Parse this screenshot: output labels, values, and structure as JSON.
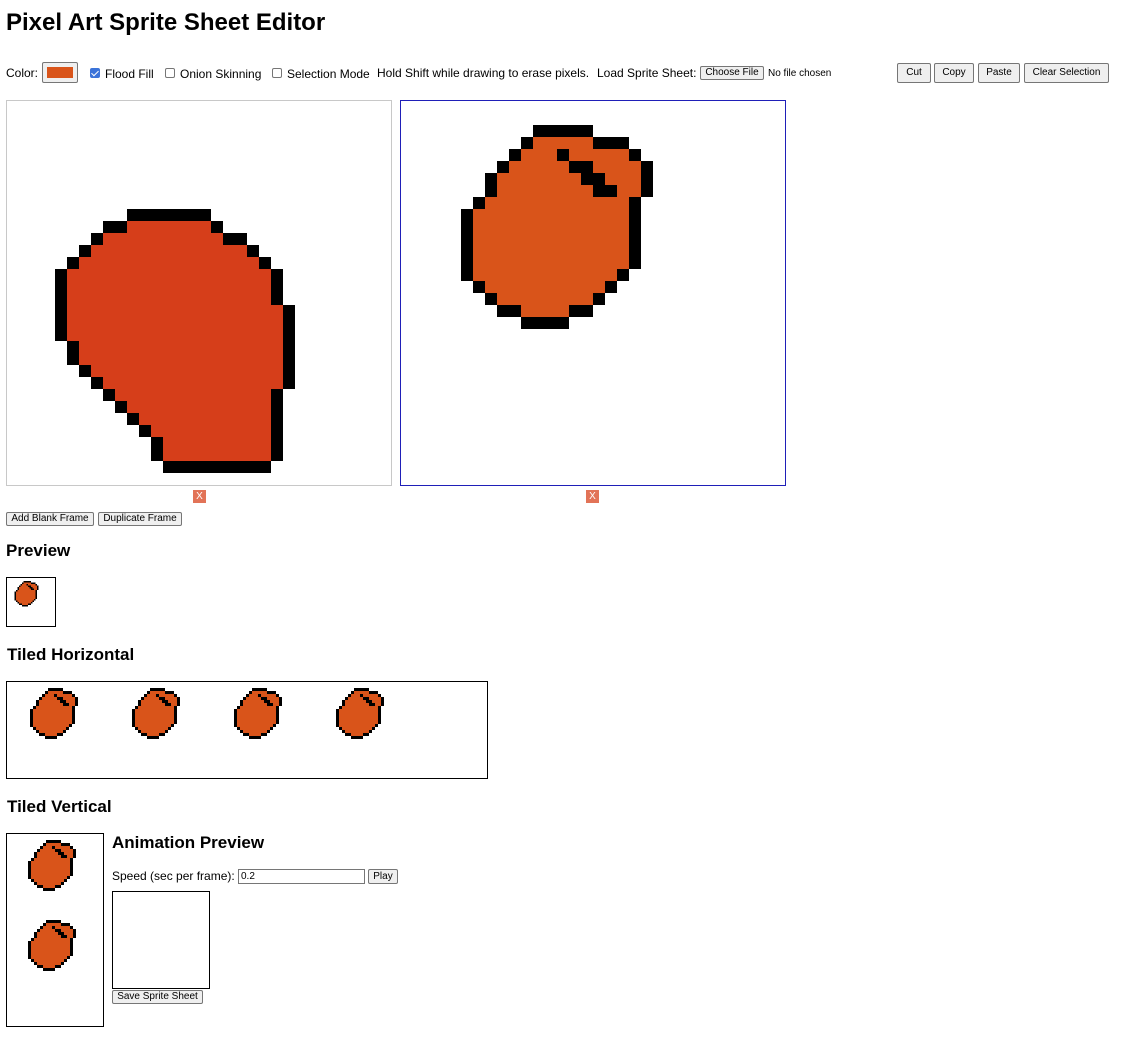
{
  "app": {
    "title": "Pixel Art Sprite Sheet Editor"
  },
  "toolbar": {
    "color_label": "Color:",
    "color_value": "#d9541a",
    "flood_fill_label": "Flood Fill",
    "flood_fill_checked": true,
    "onion_skinning_label": "Onion Skinning",
    "onion_skinning_checked": false,
    "selection_mode_label": "Selection Mode",
    "selection_mode_checked": false,
    "erase_hint": "Hold Shift while drawing to erase pixels.",
    "load_label": "Load Sprite Sheet:",
    "choose_file_label": "Choose File",
    "file_status": "No file chosen",
    "cut_label": "Cut",
    "copy_label": "Copy",
    "paste_label": "Paste",
    "clear_selection_label": "Clear Selection"
  },
  "frames": [
    {
      "selected": false,
      "fill_color": "#d63e1a",
      "delete_label": "X"
    },
    {
      "selected": true,
      "fill_color": "#d9541a",
      "delete_label": "X"
    }
  ],
  "frame_actions": {
    "add_blank_label": "Add Blank Frame",
    "duplicate_label": "Duplicate Frame"
  },
  "preview": {
    "heading": "Preview"
  },
  "tiled_horizontal": {
    "heading": "Tiled Horizontal"
  },
  "tiled_vertical": {
    "heading": "Tiled Vertical"
  },
  "animation": {
    "heading": "Animation Preview",
    "speed_label": "Speed (sec per frame):",
    "speed_value": "0.2",
    "play_label": "Play",
    "save_label": "Save Sprite Sheet"
  },
  "colors": {
    "outline": "#000000",
    "delete_button": "#e27357",
    "selected_frame_border": "#1f1fb8",
    "frame_border": "#c8c8c8"
  }
}
